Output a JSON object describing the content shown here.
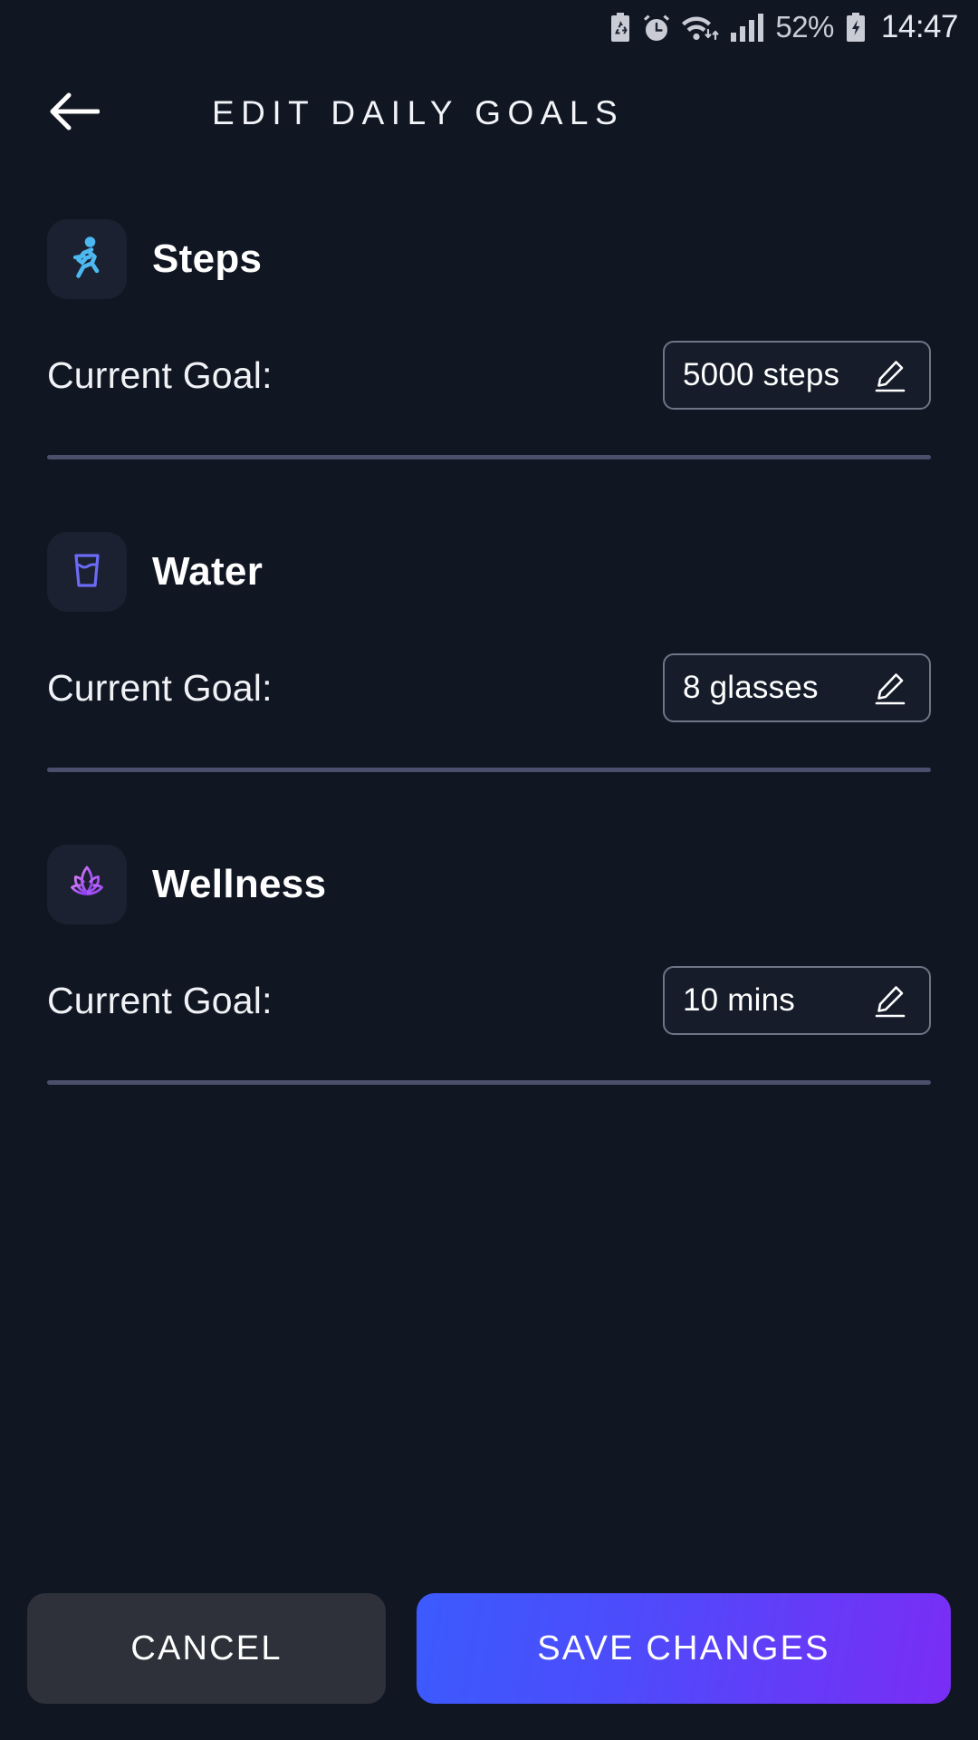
{
  "status_bar": {
    "icons": [
      "power-save-battery-icon",
      "alarm-icon",
      "wifi-icon",
      "cellular-signal-icon"
    ],
    "battery_percent": "52%",
    "battery_state_icon": "charging-battery-icon",
    "time": "14:47"
  },
  "header": {
    "back_icon": "back-arrow-icon",
    "title": "EDIT DAILY GOALS"
  },
  "goals": [
    {
      "id": "steps",
      "icon": "running-person-icon",
      "icon_color": "#4db8f0",
      "name": "Steps",
      "label": "Current Goal:",
      "value": "5000 steps",
      "edit_icon": "pencil-icon"
    },
    {
      "id": "water",
      "icon": "water-glass-icon",
      "icon_color": "#6b6bf5",
      "name": "Water",
      "label": "Current Goal:",
      "value": "8 glasses",
      "edit_icon": "pencil-icon"
    },
    {
      "id": "wellness",
      "icon": "lotus-flower-icon",
      "icon_color": "#b35cf5",
      "name": "Wellness",
      "label": "Current Goal:",
      "value": "10 mins",
      "edit_icon": "pencil-icon"
    }
  ],
  "footer": {
    "cancel_label": "CANCEL",
    "save_label": "SAVE CHANGES"
  },
  "theme": {
    "background": "#111623",
    "tile_background": "#1b2130",
    "divider": "#4b4f6b",
    "input_border": "#6f7585",
    "cancel_bg": "#2e3139",
    "save_gradient_start": "#3b5bfd",
    "save_gradient_end": "#7a2df5"
  }
}
